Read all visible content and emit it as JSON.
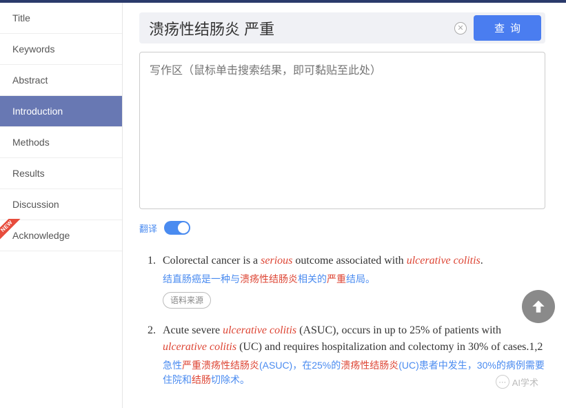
{
  "sidebar": {
    "items": [
      {
        "label": "Title"
      },
      {
        "label": "Keywords"
      },
      {
        "label": "Abstract"
      },
      {
        "label": "Introduction",
        "active": true
      },
      {
        "label": "Methods"
      },
      {
        "label": "Results"
      },
      {
        "label": "Discussion"
      },
      {
        "label": "Acknowledge",
        "new": true
      }
    ],
    "new_badge": "NEW"
  },
  "search": {
    "value": "溃疡性结肠炎 严重",
    "clear_glyph": "✕",
    "query_label": "查询"
  },
  "writebox": {
    "placeholder": "写作区（鼠标单击搜索结果，即可黏贴至此处）"
  },
  "translate": {
    "label": "翻译"
  },
  "results": [
    {
      "num": "1.",
      "en_pre": "Colorectal cancer is a ",
      "en_hl1": "serious",
      "en_mid": " outcome associated with ",
      "en_hl2": "ulcerative colitis",
      "en_post": ".",
      "zh_pre": "结直肠癌是一种与",
      "zh_hl1": "溃疡性结肠炎",
      "zh_mid": "相关的",
      "zh_hl2": "严重",
      "zh_post": "结局。",
      "source_label": "语料来源"
    },
    {
      "num": "2.",
      "en_pre": "Acute severe ",
      "en_hl1": "ulcerative colitis",
      "en_mid": " (ASUC), occurs in up to 25% of patients with ",
      "en_hl2": "ulcerative colitis",
      "en_post": " (UC) and requires hospitalization and colectomy in 30% of cases.1,2",
      "zh_pre": "急性",
      "zh_hl1": "严重溃疡性结肠炎",
      "zh_mid": "(ASUC)，在25%的",
      "zh_hl2": "溃疡性结肠炎",
      "zh_mid2": "(UC)患者中发生，30%的病例需要住院和",
      "zh_hl3": "结肠",
      "zh_post": "切除术。"
    }
  ],
  "watermark": {
    "text": "AI学术",
    "glyph": "⋯"
  }
}
